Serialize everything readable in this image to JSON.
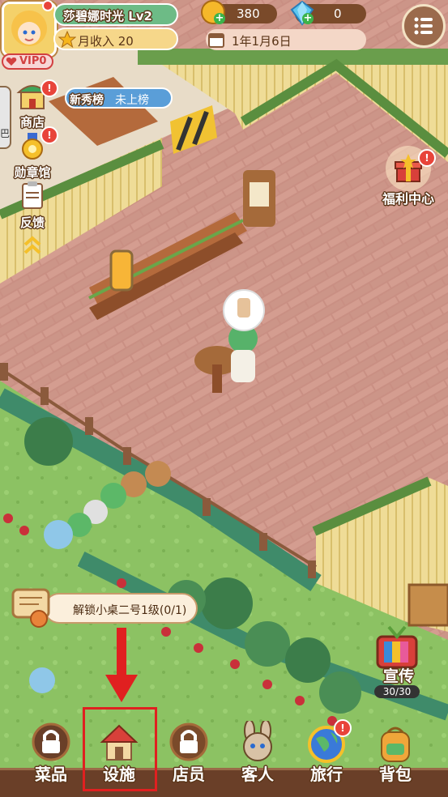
{
  "player": {
    "name": "莎碧娜时光 Lv2",
    "monthly_income": "月收入 20",
    "vip": "VIP0"
  },
  "currency": {
    "coins": "380",
    "gems": "0"
  },
  "date": "1年1月6日",
  "ranking": {
    "label": "新秀榜",
    "status": "未上榜"
  },
  "side_menu": [
    {
      "label": "商店"
    },
    {
      "label": "勋章馆"
    },
    {
      "label": "反馈"
    }
  ],
  "welfare": {
    "label": "福利中心"
  },
  "quest": {
    "text": "解锁小桌二号1级(0/1)"
  },
  "promo": {
    "label": "宣传",
    "count": "30/30"
  },
  "bottom_nav": [
    {
      "label": "菜品",
      "locked": true
    },
    {
      "label": "设施",
      "locked": false,
      "highlighted": true
    },
    {
      "label": "店员",
      "locked": true
    },
    {
      "label": "客人",
      "locked": false
    },
    {
      "label": "旅行",
      "locked": false
    },
    {
      "label": "背包",
      "locked": false
    }
  ],
  "colors": {
    "floor": "#c98f83",
    "grass": "#7fb85a",
    "fence": "#e9d38a",
    "highlight_red": "#e02020"
  }
}
